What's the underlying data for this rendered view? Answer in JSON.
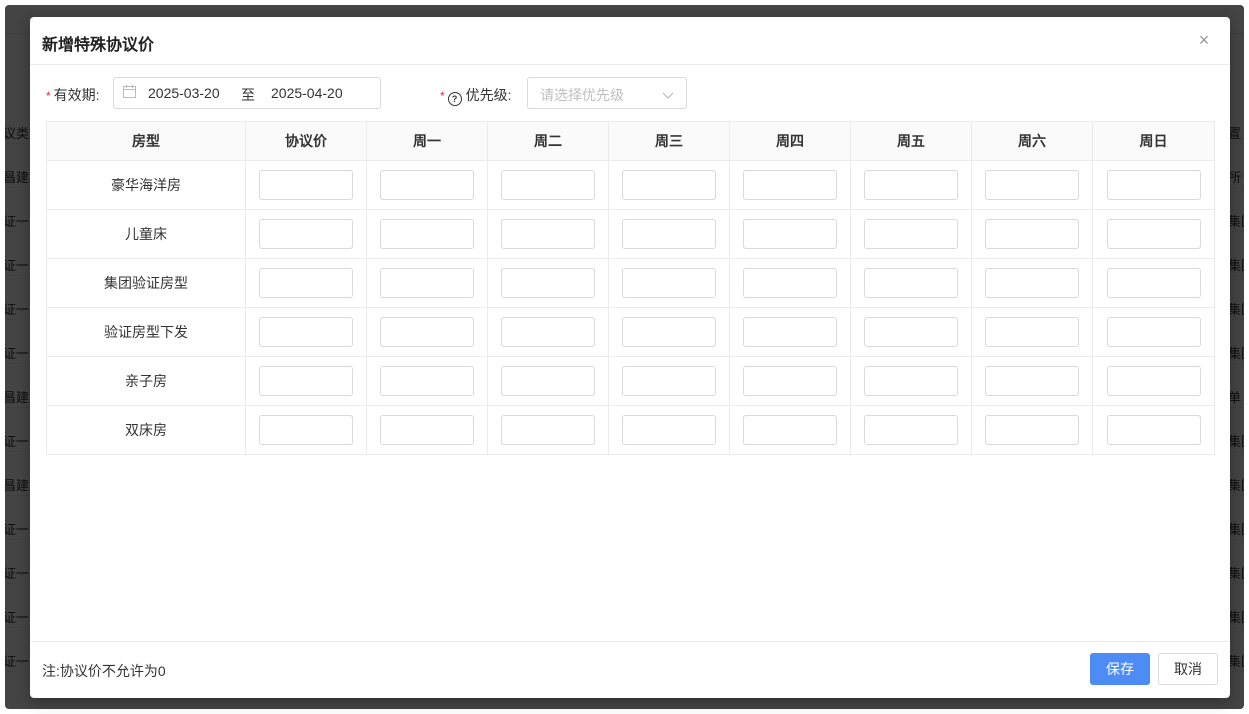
{
  "background": {
    "left_fragments": [
      "议类型",
      "昌建三",
      "证一",
      "证一",
      "证一",
      "证一",
      "昌建三",
      "证一",
      "昌建三",
      "证一",
      "证一",
      "证一",
      "证一"
    ],
    "right_fragments": [
      "置",
      "所",
      "集团",
      "集团",
      "集团",
      "集团",
      "单",
      "集团",
      "集团",
      "集团",
      "集团",
      "集团",
      "集团"
    ]
  },
  "modal": {
    "title": "新增特殊协议价",
    "close_label": "×"
  },
  "form": {
    "validity_label": "有效期:",
    "required_mark": "*",
    "start_date": "2025-03-20",
    "range_separator": "至",
    "end_date": "2025-04-20",
    "priority_label": "优先级:",
    "priority_help": "?",
    "priority_placeholder": "请选择优先级"
  },
  "table": {
    "headers": [
      "房型",
      "协议价",
      "周一",
      "周二",
      "周三",
      "周四",
      "周五",
      "周六",
      "周日"
    ],
    "rows": [
      "豪华海洋房",
      "儿童床",
      "集团验证房型",
      "验证房型下发",
      "亲子房",
      "双床房"
    ]
  },
  "footer": {
    "note": "注:协议价不允许为0",
    "save_label": "保存",
    "cancel_label": "取消"
  },
  "colors": {
    "primary": "#4d8cf5",
    "required": "#f5222d",
    "placeholder": "#bfbfbf"
  }
}
